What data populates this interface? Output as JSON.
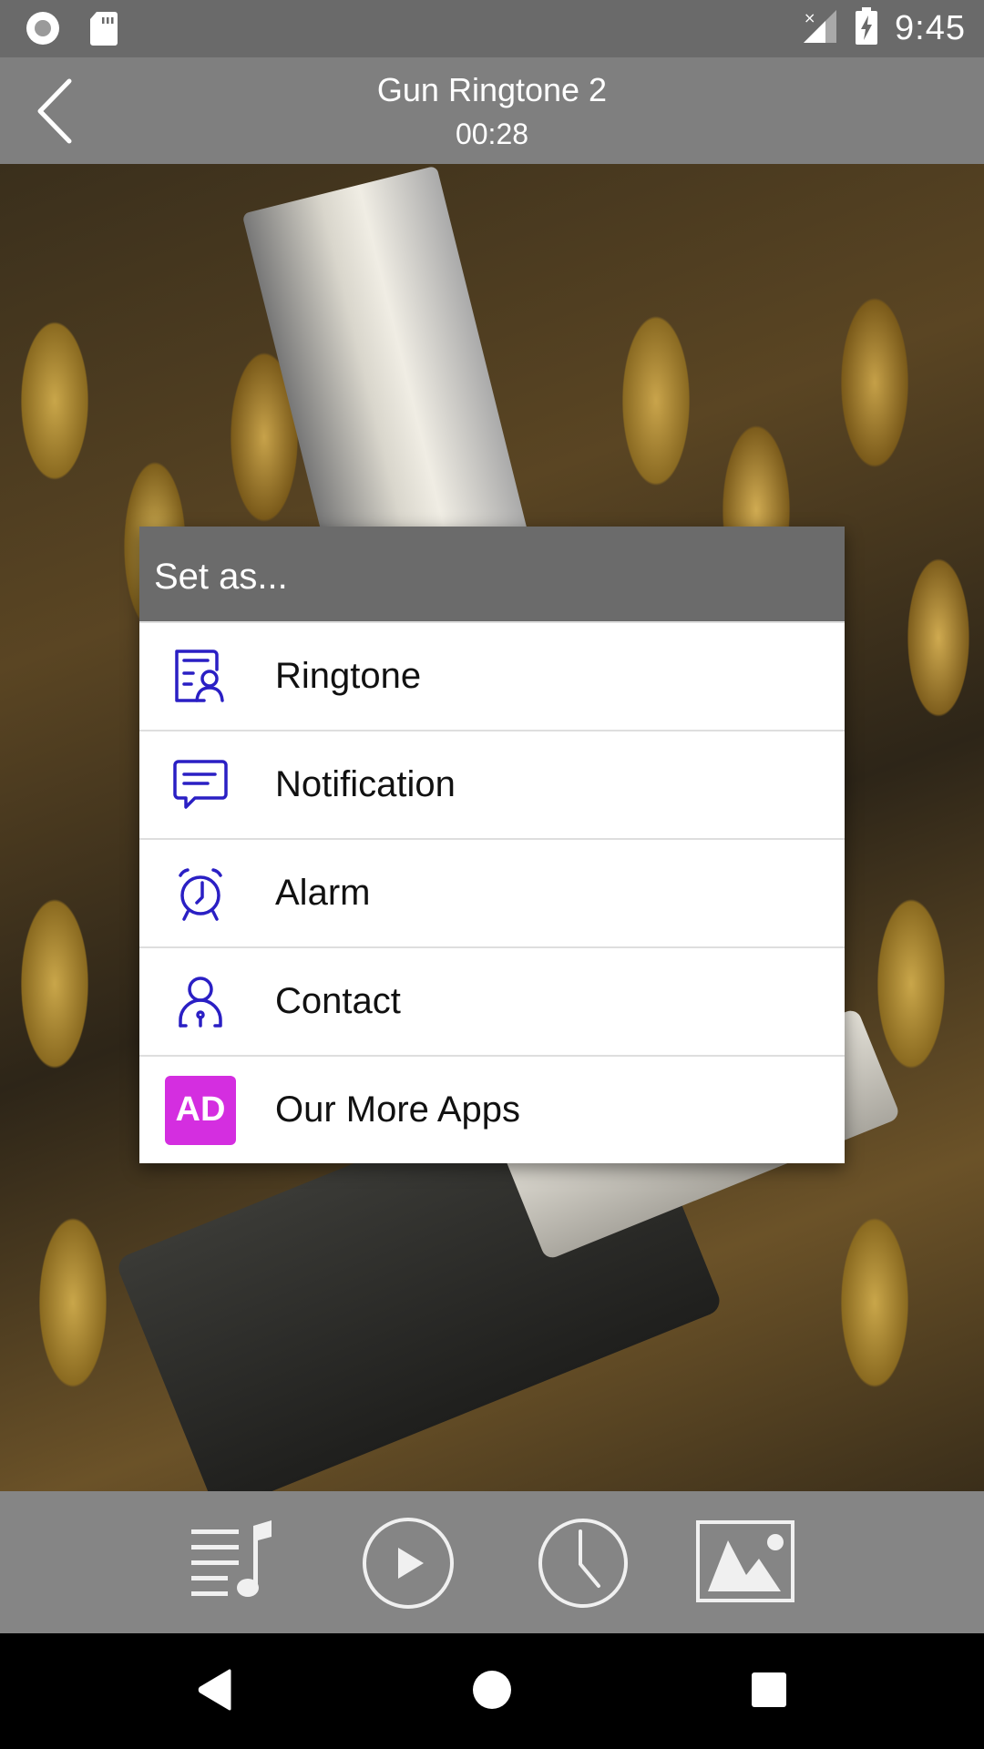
{
  "status_bar": {
    "time": "9:45",
    "left_icons": [
      "sync-circle-icon",
      "sd-card-icon"
    ],
    "right_icons": [
      "signal-no-data-icon",
      "battery-charging-icon"
    ]
  },
  "app_bar": {
    "back_icon": "chevron-left-icon",
    "title": "Gun Ringtone 2",
    "subtitle": "00:28"
  },
  "hero": {
    "description": "Bullets and pistol wallpaper"
  },
  "dialog": {
    "title": "Set as...",
    "icon_color": "#2a1fc4",
    "ad_color": "#d42ee0",
    "items": [
      {
        "label": "Ringtone",
        "icon": "ringtone-contact-card-icon"
      },
      {
        "label": "Notification",
        "icon": "message-bubble-icon"
      },
      {
        "label": "Alarm",
        "icon": "alarm-clock-icon"
      },
      {
        "label": "Contact",
        "icon": "contact-person-icon"
      },
      {
        "label": "Our More Apps",
        "icon": "ad-badge-icon",
        "badge": "AD"
      }
    ]
  },
  "bottom_bar": {
    "buttons": [
      {
        "name": "playlist",
        "icon": "playlist-music-icon"
      },
      {
        "name": "play",
        "icon": "play-circle-icon"
      },
      {
        "name": "timer",
        "icon": "clock-icon"
      },
      {
        "name": "wallpaper",
        "icon": "image-icon"
      }
    ]
  },
  "nav_bar": {
    "buttons": [
      "back",
      "home",
      "recents"
    ]
  }
}
